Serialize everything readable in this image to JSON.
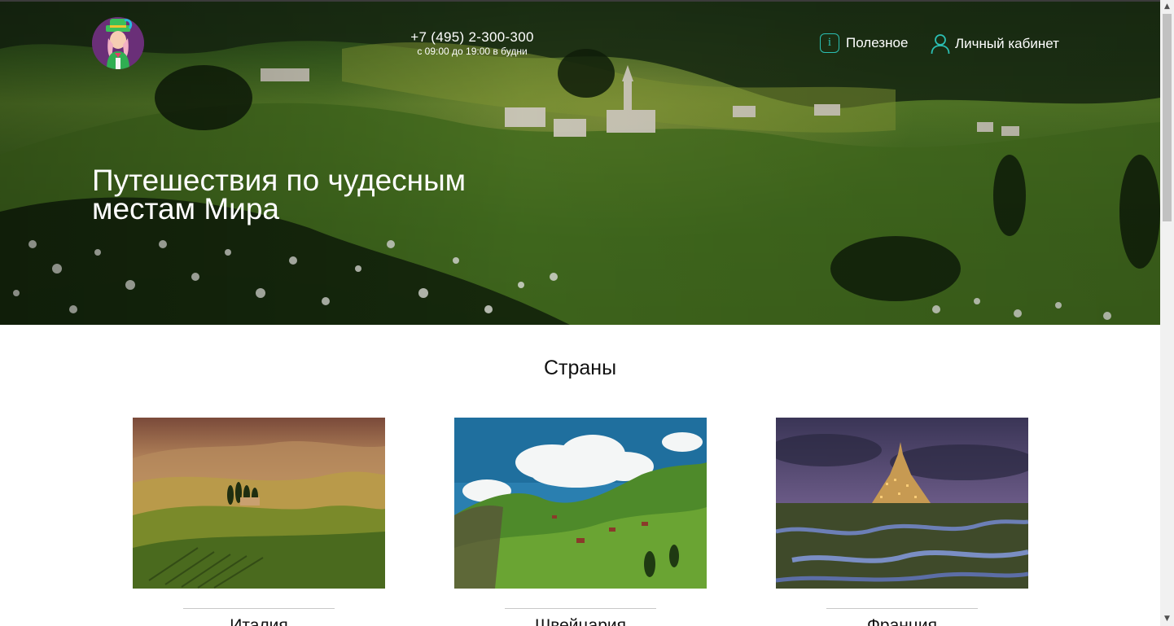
{
  "header": {
    "phone": "+7 (495) 2-300-300",
    "hours": "с 09:00 до 19:00 в будни",
    "nav": {
      "useful_label": "Полезное",
      "useful_icon": "info-icon",
      "account_label": "Личный кабинет",
      "account_icon": "user-icon"
    },
    "logo_icon": "mascot-logo-icon"
  },
  "hero": {
    "title": "Путешествия по чудесным местам Мира"
  },
  "countries_section": {
    "title": "Страны",
    "items": [
      {
        "name": "Италия",
        "image": "tuscany-hills-photo"
      },
      {
        "name": "Швейцария",
        "image": "swiss-alps-photo"
      },
      {
        "name": "Франция",
        "image": "mont-saint-michel-photo"
      }
    ]
  },
  "colors": {
    "accent_teal": "#2bbfb3",
    "text_dark": "#111111",
    "divider": "#c8c8c8"
  }
}
